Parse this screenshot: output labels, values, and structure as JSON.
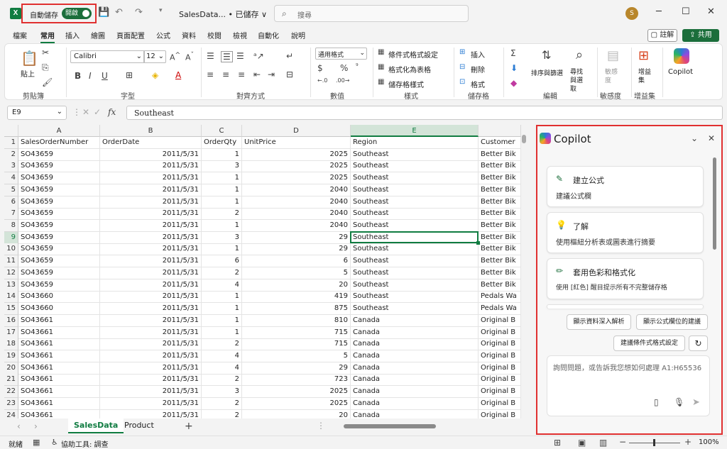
{
  "titlebar": {
    "logo": "X",
    "autosave_label": "自動儲存",
    "autosave_state": "開啟",
    "doc_title": "SalesData... • 已儲存 ∨",
    "search_placeholder": "搜尋",
    "avatar_initial": "S",
    "minimize": "─",
    "restore": "☐",
    "close": "✕"
  },
  "menu": {
    "tabs": [
      "檔案",
      "常用",
      "插入",
      "繪圖",
      "頁面配置",
      "公式",
      "資料",
      "校閱",
      "檢視",
      "自動化",
      "說明"
    ],
    "active_tab": "常用",
    "comment": "註解",
    "share": "共用"
  },
  "ribbon": {
    "groups": [
      "剪貼簿",
      "字型",
      "對齊方式",
      "數值",
      "樣式",
      "儲存格",
      "編輯",
      "敏感度",
      "增益集"
    ],
    "paste": "貼上",
    "font_name": "Calibri",
    "font_size": "12",
    "number_format": "通用格式",
    "cond_format": "條件式格式設定",
    "format_table": "格式化為表格",
    "cell_styles": "儲存格樣式",
    "insert": "插入",
    "delete": "刪除",
    "format": "格式",
    "sort_filter": "排序與篩選",
    "find_select": "尋找與選取",
    "sensitivity": "敏感度",
    "addins": "增益集",
    "copilot": "Copilot"
  },
  "formula_bar": {
    "cell_ref": "E9",
    "content": "Southeast"
  },
  "sheet": {
    "columns": [
      "A",
      "B",
      "C",
      "D",
      "E",
      ""
    ],
    "selected_col": "E",
    "selected_row": 9,
    "header_row": [
      "SalesOrderNumber",
      "OrderDate",
      "OrderQty",
      "UnitPrice",
      "Region",
      "Customer"
    ],
    "rows": [
      [
        "SO43659",
        "2011/5/31",
        "1",
        "2025",
        "Southeast",
        "Better Bik"
      ],
      [
        "SO43659",
        "2011/5/31",
        "3",
        "2025",
        "Southeast",
        "Better Bik"
      ],
      [
        "SO43659",
        "2011/5/31",
        "1",
        "2025",
        "Southeast",
        "Better Bik"
      ],
      [
        "SO43659",
        "2011/5/31",
        "1",
        "2040",
        "Southeast",
        "Better Bik"
      ],
      [
        "SO43659",
        "2011/5/31",
        "1",
        "2040",
        "Southeast",
        "Better Bik"
      ],
      [
        "SO43659",
        "2011/5/31",
        "2",
        "2040",
        "Southeast",
        "Better Bik"
      ],
      [
        "SO43659",
        "2011/5/31",
        "1",
        "2040",
        "Southeast",
        "Better Bik"
      ],
      [
        "SO43659",
        "2011/5/31",
        "3",
        "29",
        "Southeast",
        "Better Bik"
      ],
      [
        "SO43659",
        "2011/5/31",
        "1",
        "29",
        "Southeast",
        "Better Bik"
      ],
      [
        "SO43659",
        "2011/5/31",
        "6",
        "6",
        "Southeast",
        "Better Bik"
      ],
      [
        "SO43659",
        "2011/5/31",
        "2",
        "5",
        "Southeast",
        "Better Bik"
      ],
      [
        "SO43659",
        "2011/5/31",
        "4",
        "20",
        "Southeast",
        "Better Bik"
      ],
      [
        "SO43660",
        "2011/5/31",
        "1",
        "419",
        "Southeast",
        "Pedals Wa"
      ],
      [
        "SO43660",
        "2011/5/31",
        "1",
        "875",
        "Southeast",
        "Pedals Wa"
      ],
      [
        "SO43661",
        "2011/5/31",
        "1",
        "810",
        "Canada",
        "Original B"
      ],
      [
        "SO43661",
        "2011/5/31",
        "1",
        "715",
        "Canada",
        "Original B"
      ],
      [
        "SO43661",
        "2011/5/31",
        "2",
        "715",
        "Canada",
        "Original B"
      ],
      [
        "SO43661",
        "2011/5/31",
        "4",
        "5",
        "Canada",
        "Original B"
      ],
      [
        "SO43661",
        "2011/5/31",
        "4",
        "29",
        "Canada",
        "Original B"
      ],
      [
        "SO43661",
        "2011/5/31",
        "2",
        "723",
        "Canada",
        "Original B"
      ],
      [
        "SO43661",
        "2011/5/31",
        "3",
        "2025",
        "Canada",
        "Original B"
      ],
      [
        "SO43661",
        "2011/5/31",
        "2",
        "2025",
        "Canada",
        "Original B"
      ],
      [
        "SO43661",
        "2011/5/31",
        "2",
        "20",
        "Canada",
        "Original B"
      ]
    ],
    "sheet_tabs": [
      "SalesData",
      "Product"
    ],
    "active_sheet": "SalesData",
    "add_sheet": "+"
  },
  "status": {
    "ready": "就緒",
    "accessibility": "協助工具: 調查",
    "zoom": "100%"
  },
  "copilot": {
    "title": "Copilot",
    "cards": [
      {
        "icon": "pencil-spark-icon",
        "title": "建立公式",
        "desc": "建議公式欄"
      },
      {
        "icon": "lightbulb-icon",
        "title": "了解",
        "desc": "使用樞紐分析表或圖表進行摘要"
      },
      {
        "icon": "pen-icon",
        "title": "套用色彩和格式化",
        "desc": "使用 [紅色] 醒目提示所有不完整儲存格"
      }
    ],
    "chips": [
      "顯示資料深入解析",
      "顯示公式欄位的建議",
      "建議條件式格式設定"
    ],
    "input_placeholder": "詢問問題，或告訴我您想如何處理 A1:H65536"
  }
}
